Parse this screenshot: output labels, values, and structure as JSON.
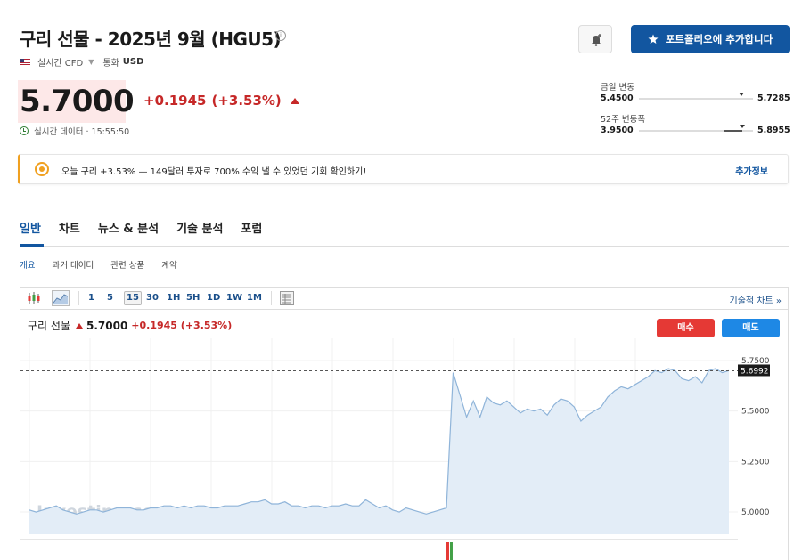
{
  "header": {
    "title": "구리 선물 - 2025년 9월 (HGU5)",
    "source": "실시간 CFD",
    "currency_label": "통화",
    "currency": "USD",
    "portfolio_button": "포트폴리오에 추가합니다"
  },
  "quote": {
    "price": "5.7000",
    "change": "+0.1945",
    "change_pct": "(+3.53%)",
    "realtime": "실시간 데이터 · 15:55:50",
    "price_bg_color": "#fde8e8",
    "negative_color": "#c62828"
  },
  "ranges": {
    "day": {
      "label": "금일 변동",
      "low": "5.4500",
      "high": "5.7285",
      "current_fraction": 0.9
    },
    "week52": {
      "label": "52주 변동폭",
      "low": "3.9500",
      "high": "5.8955",
      "current_fraction": 0.91
    }
  },
  "banner": {
    "text": "오늘 구리 +3.53% — 149달러 투자로 700% 수익 낼 수 있었던 기회 확인하기!",
    "link": "추가정보"
  },
  "tabs": [
    "일반",
    "차트",
    "뉴스 & 분석",
    "기술 분석",
    "포럼"
  ],
  "subtabs": [
    "개요",
    "과거 데이터",
    "관련 상품",
    "계약"
  ],
  "chart_toolbar": {
    "intervals": [
      "1",
      "5",
      "15",
      "30",
      "1H",
      "5H",
      "1D",
      "1W",
      "1M"
    ],
    "selected": "15",
    "advanced_link": "기술적 차트 »"
  },
  "chart_header": {
    "name": "구리 선물",
    "price": "5.7000",
    "change": "+0.1945 (+3.53%)",
    "buy": "매수",
    "sell": "매도"
  },
  "chart_data": {
    "type": "area",
    "watermark": "Investing.com",
    "y_ticks": [
      "5.7500",
      "5.5000",
      "5.2500",
      "5.0000"
    ],
    "ylim": [
      4.89,
      5.86
    ],
    "last_value_label": "5.6992",
    "last_value": 5.6992,
    "line_color": "#8fb4d9",
    "fill_color": "#e3edf7",
    "values": [
      5.01,
      5.0,
      5.01,
      5.02,
      5.03,
      5.01,
      5.0,
      4.99,
      5.0,
      5.01,
      5.01,
      5.0,
      5.01,
      5.02,
      5.02,
      5.02,
      5.01,
      5.01,
      5.02,
      5.02,
      5.03,
      5.03,
      5.02,
      5.03,
      5.02,
      5.03,
      5.03,
      5.02,
      5.02,
      5.03,
      5.03,
      5.03,
      5.04,
      5.05,
      5.05,
      5.06,
      5.04,
      5.04,
      5.05,
      5.03,
      5.03,
      5.02,
      5.03,
      5.03,
      5.02,
      5.03,
      5.03,
      5.04,
      5.03,
      5.03,
      5.06,
      5.04,
      5.02,
      5.03,
      5.01,
      5.0,
      5.02,
      5.01,
      5.0,
      4.99,
      5.0,
      5.01,
      5.02,
      5.69,
      5.58,
      5.47,
      5.55,
      5.47,
      5.57,
      5.54,
      5.53,
      5.55,
      5.52,
      5.49,
      5.51,
      5.5,
      5.51,
      5.48,
      5.53,
      5.56,
      5.55,
      5.52,
      5.45,
      5.48,
      5.5,
      5.52,
      5.57,
      5.6,
      5.62,
      5.61,
      5.63,
      5.65,
      5.67,
      5.7,
      5.69,
      5.71,
      5.7,
      5.66,
      5.65,
      5.67,
      5.64,
      5.7,
      5.71,
      5.69,
      5.7
    ],
    "volume_bars": [
      {
        "value": 1,
        "color": "#e53935"
      },
      {
        "value": 1,
        "color": "#43a047"
      }
    ]
  }
}
